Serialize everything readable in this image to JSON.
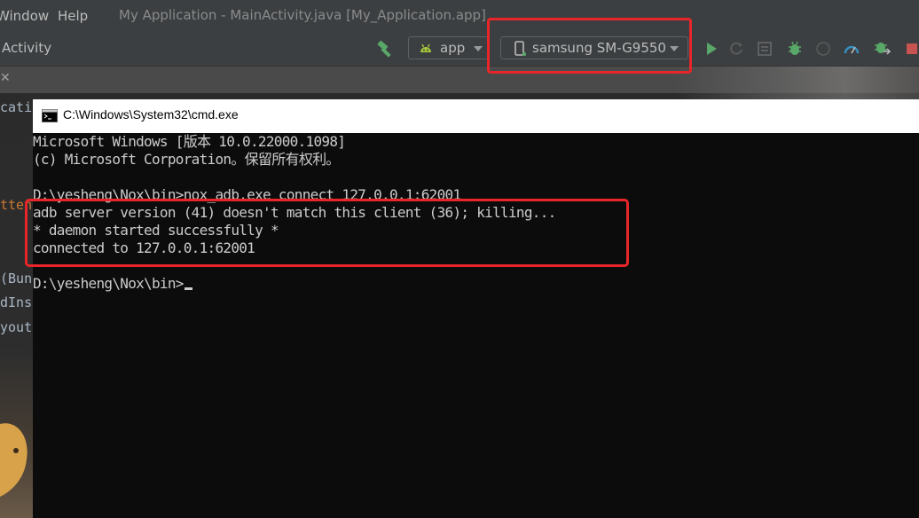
{
  "ide": {
    "menu": {
      "window": "Window",
      "help": "Help"
    },
    "window_title": "My Application - MainActivity.java [My_Application.app]",
    "breadcrumb": "Activity",
    "run_config": "app",
    "device": "samsung SM-G9550",
    "code_fragments": [
      "catio",
      "tten",
      "(Bund",
      "dInst",
      "yout"
    ],
    "colors": {
      "orange_code": "#cc7832",
      "run_green": "#59a869",
      "highlight_red": "#e8262a"
    }
  },
  "cmd": {
    "title": "C:\\Windows\\System32\\cmd.exe",
    "lines": [
      "Microsoft Windows [版本 10.0.22000.1098]",
      "(c) Microsoft Corporation。保留所有权利。",
      "",
      "D:\\yesheng\\Nox\\bin>nox_adb.exe connect 127.0.0.1:62001",
      "adb server version (41) doesn't match this client (36); killing...",
      "* daemon started successfully *",
      "connected to 127.0.0.1:62001",
      "",
      "D:\\yesheng\\Nox\\bin>"
    ]
  }
}
